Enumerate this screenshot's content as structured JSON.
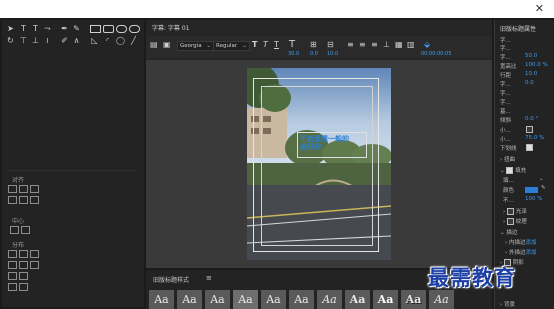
{
  "window": {
    "close_glyph": "✕"
  },
  "center": {
    "tab_title": "字幕: 字幕 01",
    "font_family": "Georgia",
    "font_style": "Regular",
    "values": [
      "30.0",
      "0.0",
      "10.0"
    ],
    "timecode": "00:00:00:05",
    "title_text_line1": "不若爱情一般的",
    "title_text_line2": "美好的"
  },
  "left": {
    "section_align": "对齐",
    "section_center": "中心",
    "section_distribute": "分布"
  },
  "styles": {
    "panel_title": "旧版标题样式",
    "swatch_label": "Aa"
  },
  "right": {
    "panel_title": "旧版标题属性",
    "props": [
      {
        "label": "字...",
        "value": ""
      },
      {
        "label": "字...",
        "value": ""
      },
      {
        "label": "字...",
        "value": "50.0"
      },
      {
        "label": "宽高比",
        "value": "100.0 %"
      },
      {
        "label": "行距",
        "value": "10.0"
      },
      {
        "label": "字...",
        "value": "0.0"
      },
      {
        "label": "字...",
        "value": ""
      },
      {
        "label": "字...",
        "value": ""
      },
      {
        "label": "基...",
        "value": ""
      },
      {
        "label": "倾斜",
        "value": "0.0 °"
      },
      {
        "label": "小...",
        "value": ""
      },
      {
        "label": "小...",
        "value": "75.0 %"
      },
      {
        "label": "下划线",
        "value": ""
      }
    ],
    "distort": "扭曲",
    "fill": "填充",
    "fill_type": "填...",
    "color_label": "颜色",
    "opacity_label": "不...",
    "opacity_value": "100 %",
    "sheen": "光泽",
    "texture": "纹理",
    "stroke": "描边",
    "inner_stroke": "内描边",
    "add": "添加",
    "outer_stroke": "外描边",
    "shadow": "阴影",
    "bottom": "背景"
  },
  "watermark": "最需教育",
  "colors": {
    "accent": "#3d9cf0",
    "fill_swatch": "#2a7fd4"
  }
}
